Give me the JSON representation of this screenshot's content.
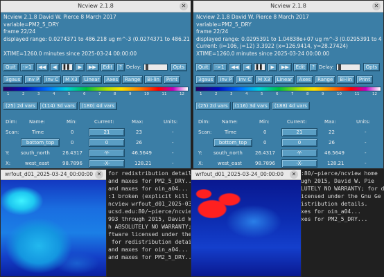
{
  "left_window": {
    "title": "Ncview 2.1.8",
    "header": "Ncview 2.1.8 David W. Pierce  8 March 2017",
    "variable": "variable=PM2_5_DRY",
    "frame": "frame 22/24",
    "range": "displayed range: 0.0274371 to 486.218 ug m^-3 (0.0274371 to 486.21",
    "current": "",
    "time": "XTIME=1260.0 minutes since 2025-03-24 00:00:00",
    "buttons_row1": [
      "Quit",
      "->1",
      "◀◀",
      "◀",
      "▌▌",
      "▶",
      "▶▶",
      "Edit",
      "?",
      "Delay:",
      "Opts"
    ],
    "buttons_row2": [
      "3gaus",
      "Inv P",
      "Inv C",
      "M X3",
      "Linear",
      "Axes",
      "Range",
      "Bi-lin",
      "Print"
    ],
    "cbar_ticks": [
      "1",
      "2",
      "3",
      "4",
      "5",
      "6",
      "7",
      "8",
      "9",
      "10",
      "11",
      "12"
    ],
    "var_buttons": [
      "(25) 2d vars",
      "(114) 3d vars",
      "(180) 4d vars"
    ],
    "table_headers": [
      "Dim:",
      "Name:",
      "Min:",
      "Current:",
      "Max:",
      "Units:"
    ],
    "table_rows": [
      {
        "dim": "Scan:",
        "name": "Time",
        "min": "0",
        "current": "21",
        "max": "23",
        "units": "-"
      },
      {
        "dim": "",
        "name": "bottom_top",
        "min": "0",
        "current": "0",
        "max": "26",
        "units": "-"
      },
      {
        "dim": "Y:",
        "name": "south_north",
        "min": "26.4317",
        "current": "-Y-",
        "max": "46.5649",
        "units": "-"
      },
      {
        "dim": "X:",
        "name": "west_east",
        "min": "98.7896",
        "current": "-X-",
        "max": "128.21",
        "units": "-"
      }
    ]
  },
  "right_window": {
    "title": "Ncview 2.1.8",
    "header": "Ncview 2.1.8 David W. Pierce  8 March 2017",
    "variable": "variable=PM2_5_DRY",
    "frame": "frame 22/24",
    "range": "displayed range: 0.0295391 to 1.04838e+07 ug m^-3 (0.0295391 to 4",
    "current": "Current: (i=106, j=12) 3.3922 (x=126.9414, y=28.27424)",
    "time": "XTIME=1260.0 minutes since 2025-03-24 00:00:00",
    "buttons_row1": [
      "Quit",
      "->1",
      "◀◀",
      "◀",
      "▌▌",
      "▶",
      "▶▶",
      "Edit",
      "?",
      "Delay:",
      "Opts"
    ],
    "buttons_row2": [
      "3gaus",
      "Inv P",
      "Inv C",
      "M X3",
      "Linear",
      "Axes",
      "Range",
      "Bi-lin",
      "Print"
    ],
    "cbar_ticks": [
      "1",
      "2",
      "3",
      "4",
      "5",
      "6",
      "7",
      "8",
      "9",
      "10",
      "11",
      "12"
    ],
    "var_buttons": [
      "(25) 2d vars",
      "(116) 3d vars",
      "(188) 4d vars"
    ],
    "table_headers": [
      "Dim:",
      "Name:",
      "Min:",
      "Current:",
      "Max:",
      "Units:"
    ],
    "table_rows": [
      {
        "dim": "Scan:",
        "name": "Time",
        "min": "0",
        "current": "21",
        "max": "22",
        "units": "-"
      },
      {
        "dim": "",
        "name": "bottom_top",
        "min": "0",
        "current": "0",
        "max": "26",
        "units": "-"
      },
      {
        "dim": "Y:",
        "name": "south_north",
        "min": "26.4317",
        "current": "-Y-",
        "max": "46.5649",
        "units": "-"
      },
      {
        "dim": "X:",
        "name": "west_east",
        "min": "98.7896",
        "current": "-X-",
        "max": "128.21",
        "units": "-"
      }
    ]
  },
  "left_image_window": {
    "title": "wrfout_d01_2025-03-24_00:00:00"
  },
  "right_image_window": {
    "title": "wrfout_d01_2025-03-24_00:00:00"
  },
  "terminal_left": [
    "for redistribution details.",
    "",
    "and maxes for PM2_5_DRY...",
    "and maxes for oin_a04...",
    ":1 broken (explicit kill o",
    "ncview wrfout_d01_2025-03-",
    "ucsd.edu:80/~pierce/ncview",
    "993 through 2015, David W.",
    "h ABSOLUTELY NO WARRANTY;",
    "ftware licensed under the Gn",
    " for redistribution details.",
    "",
    "and maxes for oin_a04...",
    "and maxes for PM2_5_DRY..."
  ],
  "terminal_right": [
    ":80/~pierce/ncview home",
    "ugh 2015, David W. Pie",
    "LUTELY NO WARRANTY; for d",
    "icensed under the Gnu Ge",
    "istribution details.",
    "",
    "xes for oin_a04...",
    "xes for PM2_5_DRY..."
  ]
}
